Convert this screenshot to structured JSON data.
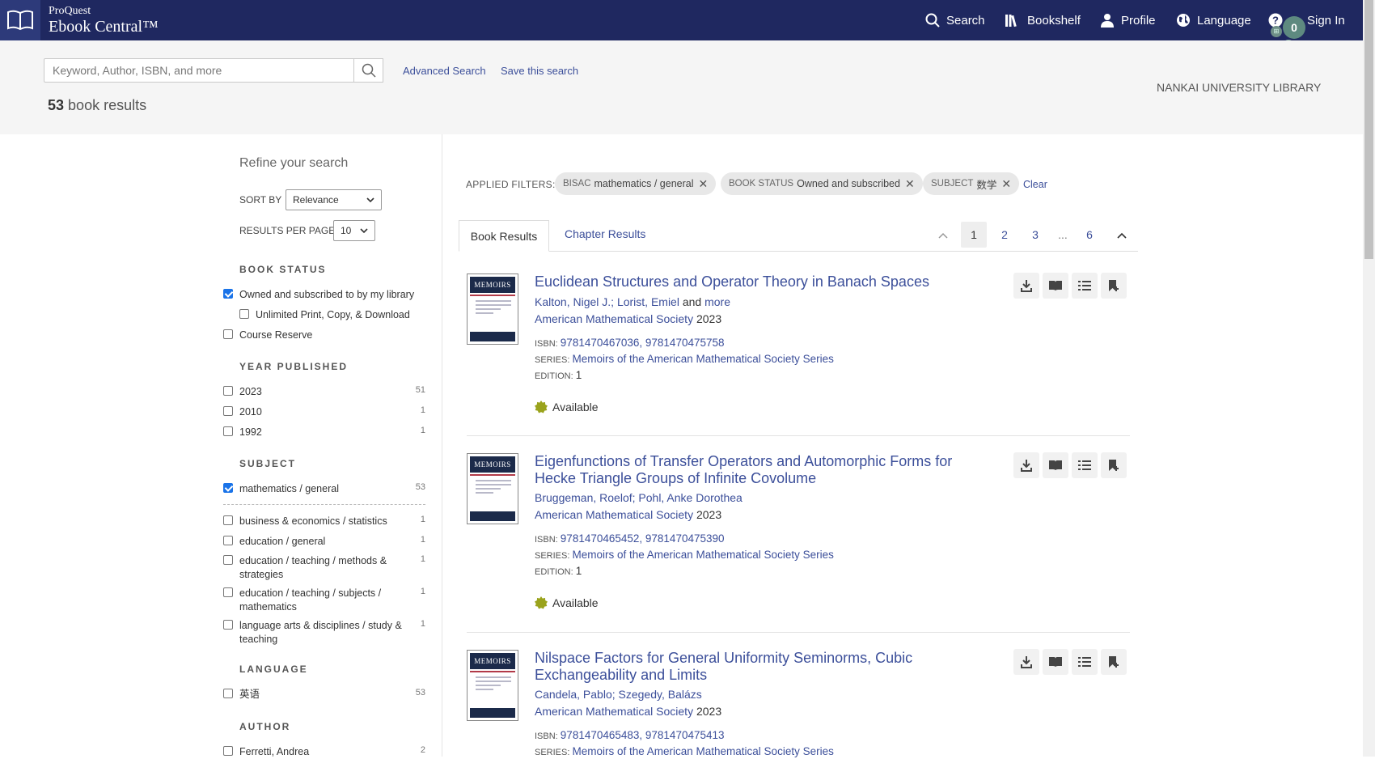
{
  "header": {
    "brand_line1": "ProQuest",
    "brand_line2": "Ebook Central™",
    "nav": {
      "search": "Search",
      "bookshelf": "Bookshelf",
      "profile": "Profile",
      "language": "Language",
      "sign_in": "Sign In"
    },
    "cart_count": "0",
    "colors": {
      "bar": "#1f2860",
      "accent": "#3c4f9a"
    }
  },
  "search": {
    "placeholder": "Keyword, Author, ISBN, and more",
    "advanced": "Advanced Search",
    "save": "Save this search",
    "library": "NANKAI UNIVERSITY LIBRARY",
    "count": "53",
    "count_label": "book results"
  },
  "sidebar": {
    "refine": "Refine your search",
    "sort_label": "SORT BY",
    "sort_value": "Relevance",
    "rpp_label": "RESULTS PER PAGE",
    "rpp_value": "10",
    "book_status": {
      "heading": "BOOK STATUS",
      "items": [
        {
          "label": "Owned and subscribed to by my library",
          "checked": true
        },
        {
          "label": "Unlimited Print, Copy, & Download",
          "checked": false
        },
        {
          "label": "Course Reserve",
          "checked": false
        }
      ]
    },
    "year": {
      "heading": "YEAR PUBLISHED",
      "items": [
        {
          "label": "2023",
          "count": "51"
        },
        {
          "label": "2010",
          "count": "1"
        },
        {
          "label": "1992",
          "count": "1"
        }
      ]
    },
    "subject": {
      "heading": "SUBJECT",
      "items": [
        {
          "label": "mathematics / general",
          "count": "53",
          "checked": true
        },
        {
          "label": "business & economics / statistics",
          "count": "1"
        },
        {
          "label": "education / general",
          "count": "1"
        },
        {
          "label": "education / teaching / methods & strategies",
          "count": "1"
        },
        {
          "label": "education / teaching / subjects / mathematics",
          "count": "1"
        },
        {
          "label": "language arts & disciplines / study & teaching",
          "count": "1"
        }
      ]
    },
    "language": {
      "heading": "LANGUAGE",
      "items": [
        {
          "label": "英语",
          "count": "53"
        }
      ]
    },
    "author": {
      "heading": "AUTHOR",
      "items": [
        {
          "label": "Ferretti, Andrea",
          "count": "2"
        }
      ]
    }
  },
  "filters": {
    "label": "APPLIED FILTERS:",
    "chips": [
      {
        "key": "BISAC",
        "value": "mathematics / general"
      },
      {
        "key": "BOOK STATUS",
        "value": "Owned and subscribed"
      },
      {
        "key": "SUBJECT",
        "value": "数学"
      }
    ],
    "clear": "Clear"
  },
  "tabs": {
    "book": "Book Results",
    "chapter": "Chapter Results"
  },
  "pagination": {
    "pages": [
      "1",
      "2",
      "3",
      "...",
      "6"
    ],
    "current": "1"
  },
  "results": [
    {
      "title": "Euclidean Structures and Operator Theory in Banach Spaces",
      "authors": "Kalton, Nigel J.; Lorist, Emiel",
      "and": "and",
      "more": "more",
      "publisher": "American Mathematical Society",
      "year": "2023",
      "isbn_label": "ISBN:",
      "isbn": "9781470467036, 9781470475758",
      "series_label": "SERIES:",
      "series": "Memoirs of the American Mathematical Society Series",
      "edition_label": "EDITION:",
      "edition": "1",
      "status": "Available",
      "cover_text": "MEMOIRS"
    },
    {
      "title": "Eigenfunctions of Transfer Operators and Automorphic Forms for Hecke Triangle Groups of Infinite Covolume",
      "authors": "Bruggeman, Roelof; Pohl, Anke Dorothea",
      "publisher": "American Mathematical Society",
      "year": "2023",
      "isbn_label": "ISBN:",
      "isbn": "9781470465452, 9781470475390",
      "series_label": "SERIES:",
      "series": "Memoirs of the American Mathematical Society Series",
      "edition_label": "EDITION:",
      "edition": "1",
      "status": "Available",
      "cover_text": "MEMOIRS"
    },
    {
      "title": "Nilspace Factors for General Uniformity Seminorms, Cubic Exchangeability and Limits",
      "authors": "Candela, Pablo; Szegedy, Balázs",
      "publisher": "American Mathematical Society",
      "year": "2023",
      "isbn_label": "ISBN:",
      "isbn": "9781470465483, 9781470475413",
      "series_label": "SERIES:",
      "series": "Memoirs of the American Mathematical Society Series",
      "cover_text": "MEMOIRS"
    }
  ]
}
